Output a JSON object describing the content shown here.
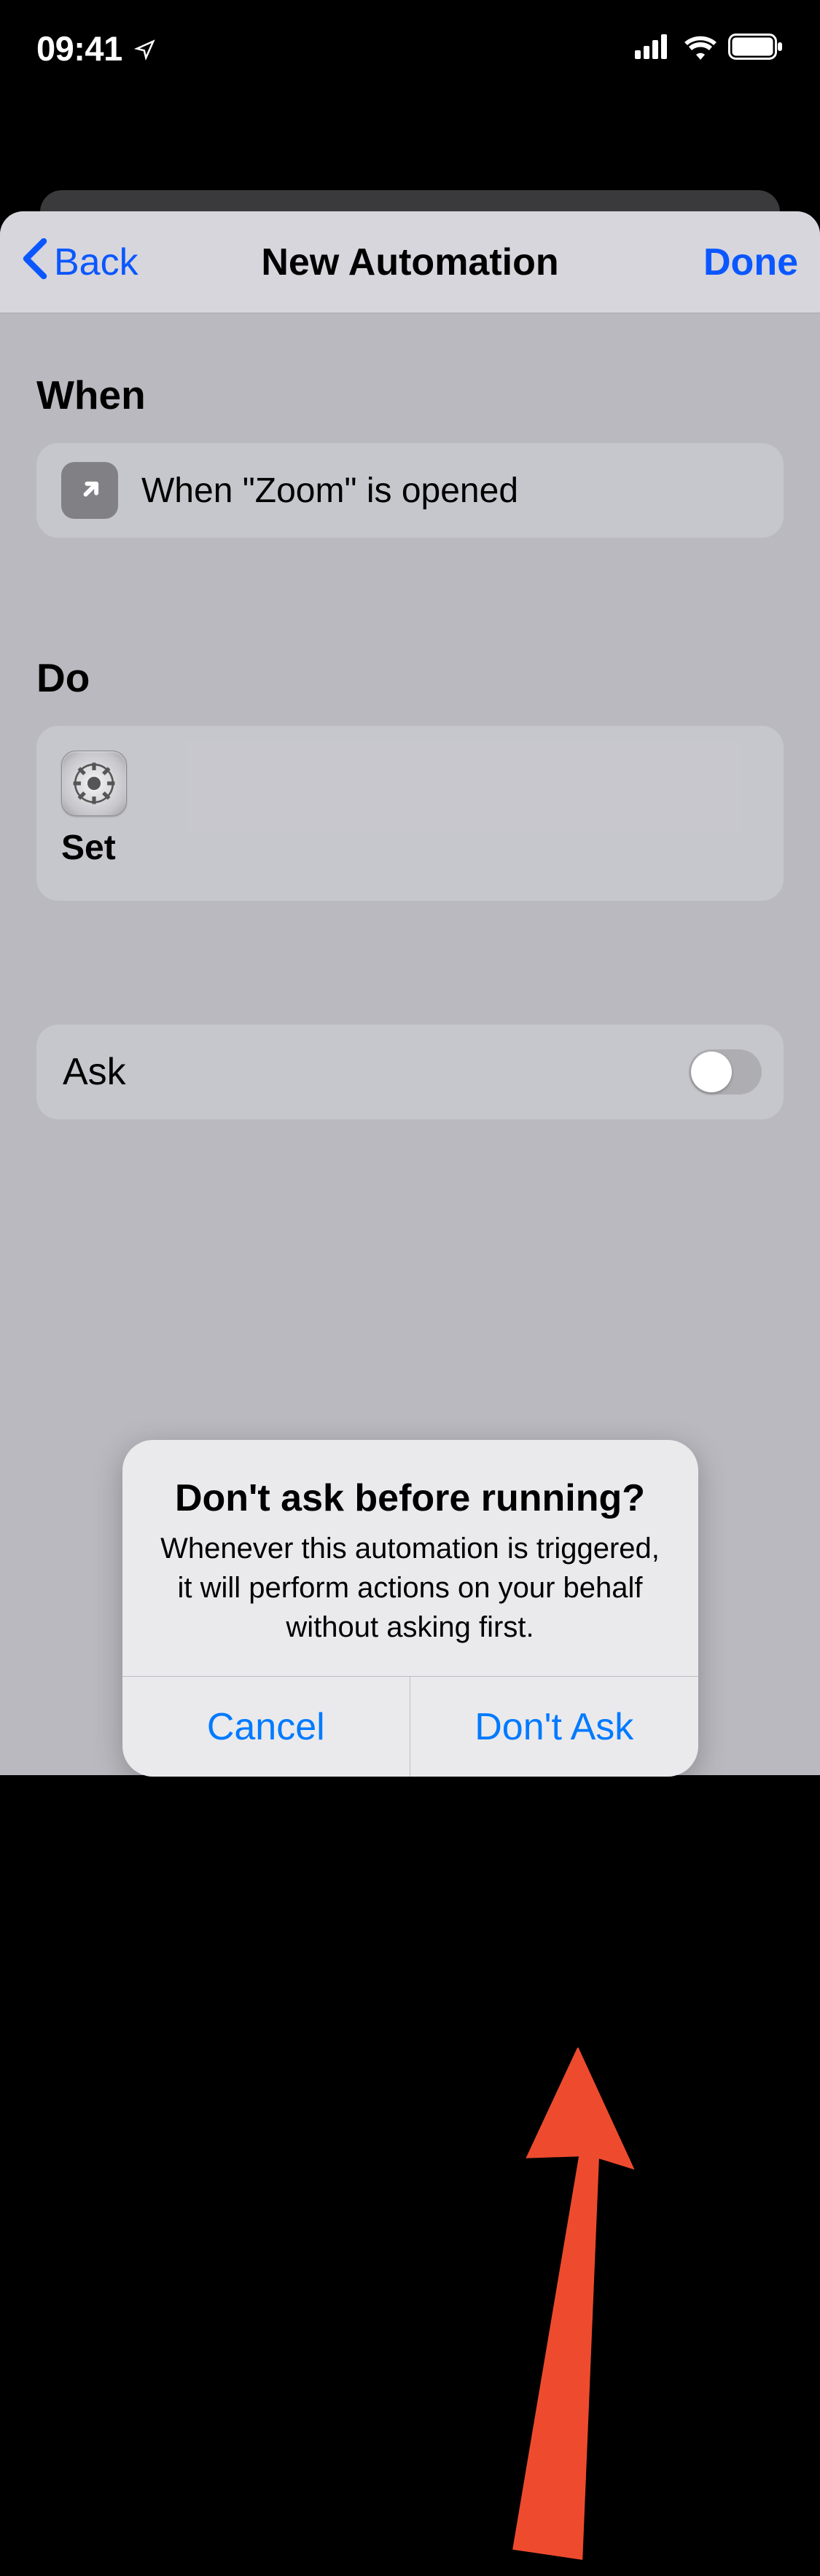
{
  "status_bar": {
    "time": "09:41"
  },
  "nav": {
    "back_label": "Back",
    "title": "New Automation",
    "done_label": "Done"
  },
  "sections": {
    "when_heading": "When",
    "when_text": "When \"Zoom\" is opened",
    "do_heading": "Do",
    "do_action_label": "Set"
  },
  "ask_row": {
    "label": "Ask"
  },
  "alert": {
    "title": "Don't ask before running?",
    "message": "Whenever this automation is triggered, it will perform actions on your behalf without asking first.",
    "cancel": "Cancel",
    "confirm": "Don't Ask"
  }
}
